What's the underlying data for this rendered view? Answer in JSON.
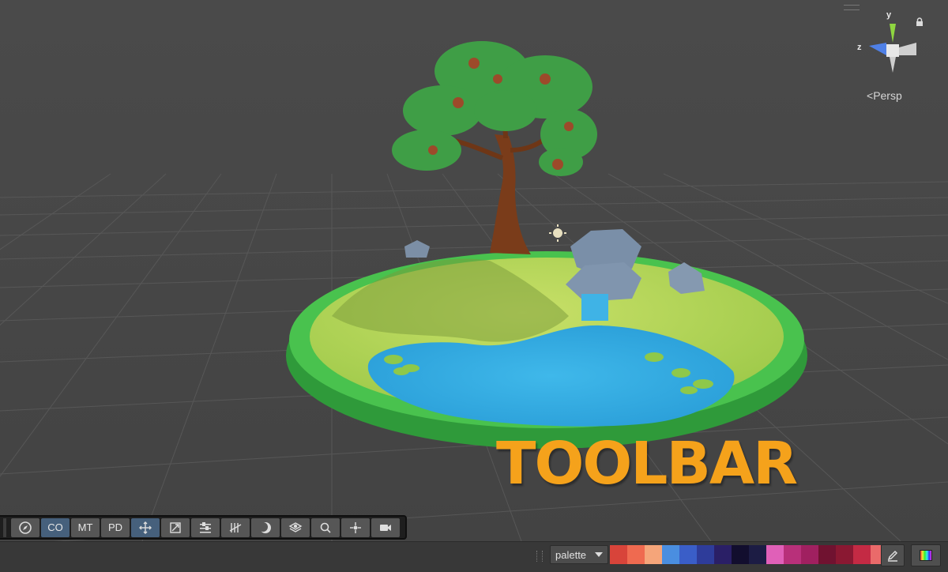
{
  "gizmo": {
    "y_label": "y",
    "z_label": "z",
    "projection_label": "Persp"
  },
  "overlay": {
    "title": "TOOLBAR"
  },
  "toolbar": {
    "buttons": [
      {
        "key": "compass",
        "label": "",
        "icon": "compass-icon",
        "active": false
      },
      {
        "key": "co",
        "label": "CO",
        "icon": "",
        "active": true
      },
      {
        "key": "mt",
        "label": "MT",
        "icon": "",
        "active": false
      },
      {
        "key": "pd",
        "label": "PD",
        "icon": "",
        "active": false
      },
      {
        "key": "move",
        "label": "",
        "icon": "move-arrows-icon",
        "active": true
      },
      {
        "key": "transform",
        "label": "",
        "icon": "transform-box-icon",
        "active": false
      },
      {
        "key": "sliders",
        "label": "",
        "icon": "sliders-icon",
        "active": false
      },
      {
        "key": "hatch",
        "label": "",
        "icon": "hatch-lines-icon",
        "active": false
      },
      {
        "key": "moon",
        "label": "",
        "icon": "moon-icon",
        "active": false
      },
      {
        "key": "layers",
        "label": "",
        "icon": "layers-icon",
        "active": false
      },
      {
        "key": "search",
        "label": "",
        "icon": "search-icon",
        "active": false
      },
      {
        "key": "scatter",
        "label": "",
        "icon": "scatter-arrows-icon",
        "active": false
      },
      {
        "key": "camera",
        "label": "",
        "icon": "video-camera-icon",
        "active": false
      }
    ]
  },
  "statusbar": {
    "palette_label": "palette",
    "swatch_colors": [
      "#d8443a",
      "#ef6a50",
      "#f5a57a",
      "#4a8ee0",
      "#3a5ec8",
      "#2e3c9a",
      "#2a1f66",
      "#120e2e",
      "#1c1c44",
      "#e060b8",
      "#b8307a",
      "#a02060",
      "#701230",
      "#8a1832",
      "#c42a44",
      "#ea6a6a"
    ]
  },
  "colors": {
    "accent": "#f5a21b",
    "active_button": "#46607c",
    "button": "#565656"
  }
}
